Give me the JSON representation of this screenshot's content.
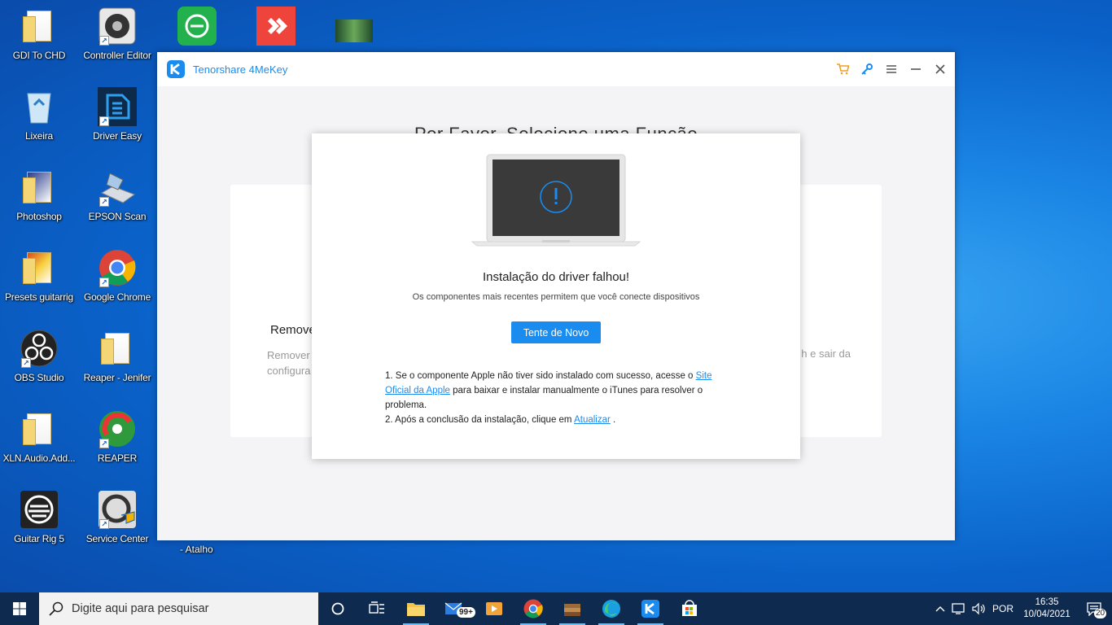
{
  "desktop": {
    "icons": [
      {
        "label": "GDI To CHD"
      },
      {
        "label": "Controller Editor"
      },
      {
        "label": "Lixeira"
      },
      {
        "label": "Driver Easy"
      },
      {
        "label": "Photoshop"
      },
      {
        "label": "EPSON Scan"
      },
      {
        "label": "Presets guitarrig"
      },
      {
        "label": "Google Chrome"
      },
      {
        "label": "OBS Studio"
      },
      {
        "label": "Reaper - Jenifer"
      },
      {
        "label": "XLN.Audio.Add..."
      },
      {
        "label": "REAPER"
      },
      {
        "label": "Guitar Rig 5"
      },
      {
        "label": "Service Center"
      }
    ],
    "partial_label_atalho": "- Atalho"
  },
  "app": {
    "title": "Tenorshare 4MeKey",
    "background_heading": "Por Favor, Selecione uma Função",
    "background_card_title": "Remover",
    "background_card_desc_line1": "Remover",
    "background_card_desc_line2": "configura",
    "background_card_desc_right": "h e sair da"
  },
  "modal": {
    "title": "Instalação do driver falhou!",
    "subtitle": "Os componentes mais recentes permitem que você conecte dispositivos",
    "retry_button": "Tente de Novo",
    "note1_prefix": "1. Se o componente Apple não tiver sido instalado com sucesso, acesse o",
    "note1_link": "Site Oficial da Apple",
    "note1_suffix": "para baixar e instalar manualmente o iTunes para resolver o problema.",
    "note2_prefix": "2. Após a conclusão da instalação, clique em",
    "note2_link": "Atualizar",
    "note2_suffix": "."
  },
  "taskbar": {
    "search_placeholder": "Digite aqui para pesquisar",
    "mail_badge": "99+",
    "language": "POR",
    "time": "16:35",
    "date": "10/04/2021",
    "notification_count": "20"
  },
  "colors": {
    "accent": "#1a8cf0",
    "taskbar": "#0e2a4e",
    "cart_icon": "#f0a020"
  }
}
